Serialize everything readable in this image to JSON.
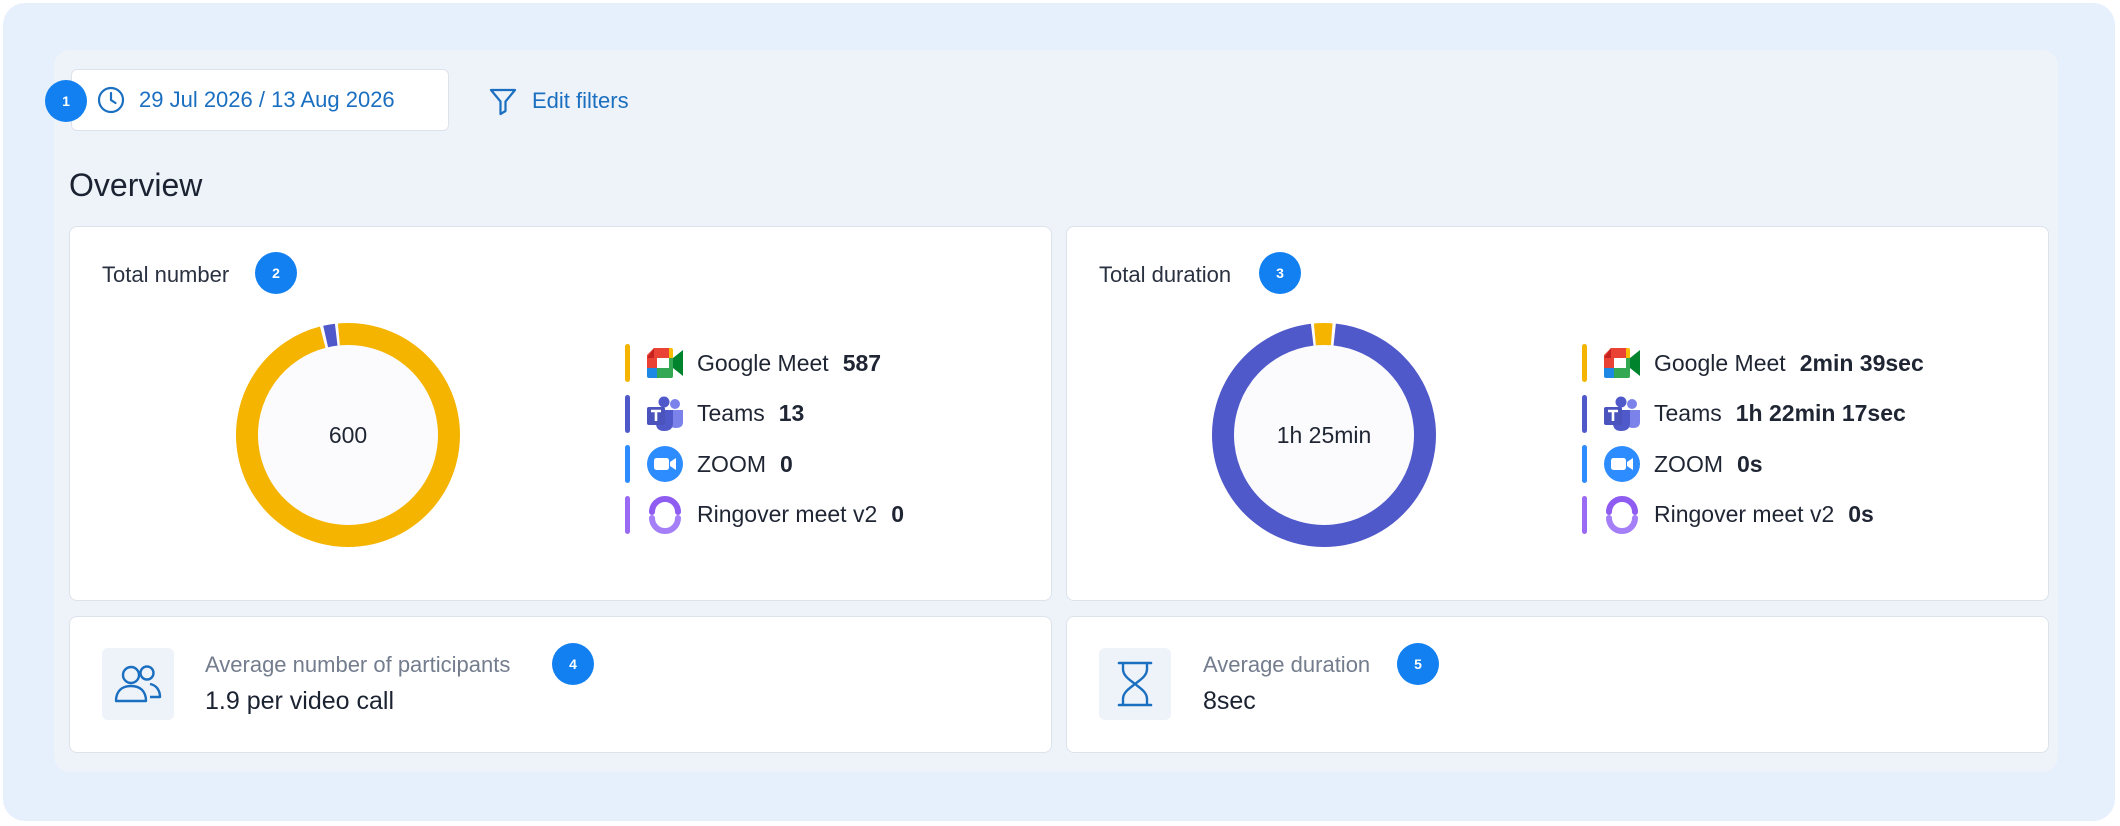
{
  "date_range": "29 Jul 2026 / 13 Aug 2026",
  "edit_filters": "Edit filters",
  "page_title": "Overview",
  "badges": [
    "1",
    "2",
    "3",
    "4",
    "5"
  ],
  "total_number": {
    "title": "Total number",
    "center": "600",
    "items": [
      {
        "name": "Google Meet",
        "value": "587",
        "color": "#f5b400",
        "icon": "google-meet-icon"
      },
      {
        "name": "Teams",
        "value": "13",
        "color": "#5059c9",
        "icon": "teams-icon"
      },
      {
        "name": "ZOOM",
        "value": "0",
        "color": "#2d8cff",
        "icon": "zoom-icon"
      },
      {
        "name": "Ringover meet v2",
        "value": "0",
        "color": "#9b6af5",
        "icon": "ringover-icon"
      }
    ],
    "chart_data": {
      "type": "pie",
      "categories": [
        "Google Meet",
        "Teams",
        "ZOOM",
        "Ringover meet v2"
      ],
      "values": [
        587,
        13,
        0,
        0
      ]
    }
  },
  "total_duration": {
    "title": "Total duration",
    "center": "1h 25min",
    "items": [
      {
        "name": "Google Meet",
        "value": "2min 39sec",
        "color": "#f5b400",
        "icon": "google-meet-icon"
      },
      {
        "name": "Teams",
        "value": "1h 22min 17sec",
        "color": "#5059c9",
        "icon": "teams-icon"
      },
      {
        "name": "ZOOM",
        "value": "0s",
        "color": "#2d8cff",
        "icon": "zoom-icon"
      },
      {
        "name": "Ringover meet v2",
        "value": "0s",
        "color": "#9b6af5",
        "icon": "ringover-icon"
      }
    ],
    "chart_data": {
      "type": "pie",
      "categories": [
        "Google Meet",
        "Teams",
        "ZOOM",
        "Ringover meet v2"
      ],
      "values": [
        159,
        4937,
        0,
        0
      ]
    }
  },
  "avg_participants": {
    "label": "Average number of participants",
    "value": "1.9 per video call",
    "icon": "users-icon"
  },
  "avg_duration": {
    "label": "Average duration",
    "value": "8sec",
    "icon": "hourglass-icon"
  }
}
